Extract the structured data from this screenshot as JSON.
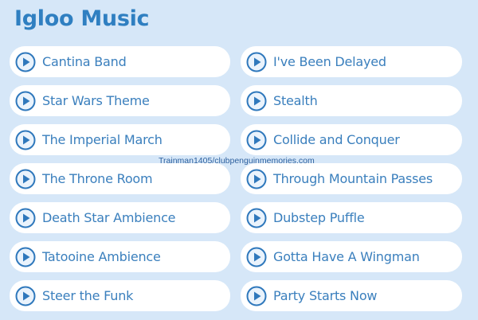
{
  "panel": {
    "title": "Igloo Music"
  },
  "left_tracks": [
    {
      "label": "Cantina Band",
      "icon": "play-icon"
    },
    {
      "label": "Star Wars Theme",
      "icon": "play-icon"
    },
    {
      "label": "The Imperial March",
      "icon": "play-icon"
    },
    {
      "label": "The Throne Room",
      "icon": "play-icon"
    },
    {
      "label": "Death Star Ambience",
      "icon": "play-icon"
    },
    {
      "label": "Tatooine Ambience",
      "icon": "play-icon"
    },
    {
      "label": "Steer the Funk",
      "icon": "play-icon"
    }
  ],
  "right_tracks": [
    {
      "label": "I've Been Delayed",
      "icon": "play-icon"
    },
    {
      "label": "Stealth",
      "icon": "play-icon"
    },
    {
      "label": "Collide and Conquer",
      "icon": "play-icon"
    },
    {
      "label": "Through Mountain Passes",
      "icon": "play-icon"
    },
    {
      "label": "Dubstep Puffle",
      "icon": "play-icon"
    },
    {
      "label": "Gotta Have A Wingman",
      "icon": "play-icon"
    },
    {
      "label": "Party Starts Now",
      "icon": "play-icon"
    }
  ],
  "watermark": "Trainman1405/clubpenguinmemories.com",
  "colors": {
    "background": "#d6e7f8",
    "title": "#2f7fc1",
    "button_bg": "#ffffff",
    "label": "#3a7fbd",
    "icon_ring": "#2f78bc",
    "icon_fill": "#eaf3fc"
  }
}
